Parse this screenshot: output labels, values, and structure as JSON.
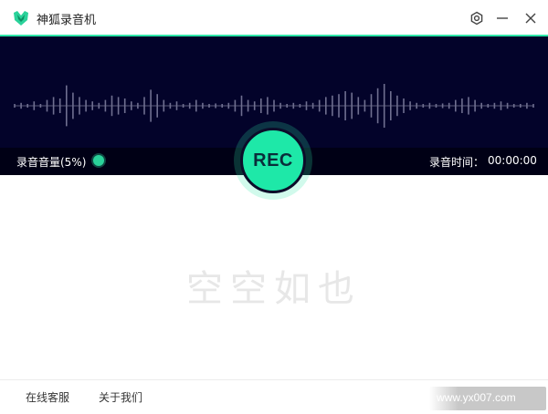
{
  "app": {
    "title": "神狐录音机",
    "accent_color": "#2ee6a8",
    "logo_icon": "fox-shield-icon"
  },
  "window_controls": {
    "settings_icon": "gear-icon",
    "minimize_icon": "minimize-icon",
    "close_icon": "close-icon"
  },
  "recorder": {
    "volume_label": "录音音量(5%)",
    "volume_percent": 5,
    "rec_label": "REC",
    "time_label": "录音时间：",
    "time_value": "00:00:00",
    "waveform_levels": [
      0.05,
      0.1,
      0.05,
      0.15,
      0.05,
      0.2,
      0.3,
      0.25,
      0.7,
      0.45,
      0.3,
      0.2,
      0.15,
      0.1,
      0.2,
      0.35,
      0.3,
      0.25,
      0.15,
      0.1,
      0.3,
      0.55,
      0.4,
      0.2,
      0.1,
      0.15,
      0.05,
      0.1,
      0.2,
      0.1,
      0.05,
      0.08,
      0.05,
      0.1,
      0.2,
      0.35,
      0.2,
      0.15,
      0.25,
      0.3,
      0.2,
      0.1,
      0.05,
      0.1,
      0.05,
      0.15,
      0.1,
      0.2,
      0.3,
      0.35,
      0.4,
      0.5,
      0.45,
      0.3,
      0.2,
      0.4,
      0.6,
      0.75,
      0.5,
      0.35,
      0.25,
      0.15,
      0.1,
      0.05,
      0.1,
      0.05,
      0.08,
      0.1,
      0.2,
      0.25,
      0.3,
      0.2,
      0.1,
      0.05,
      0.1,
      0.15,
      0.1,
      0.05,
      0.05,
      0.1,
      0.05
    ]
  },
  "main": {
    "empty_text": "空空如也"
  },
  "footer": {
    "support_label": "在线客服",
    "about_label": "关于我们"
  },
  "watermark": {
    "text": "www.yx007.com"
  }
}
